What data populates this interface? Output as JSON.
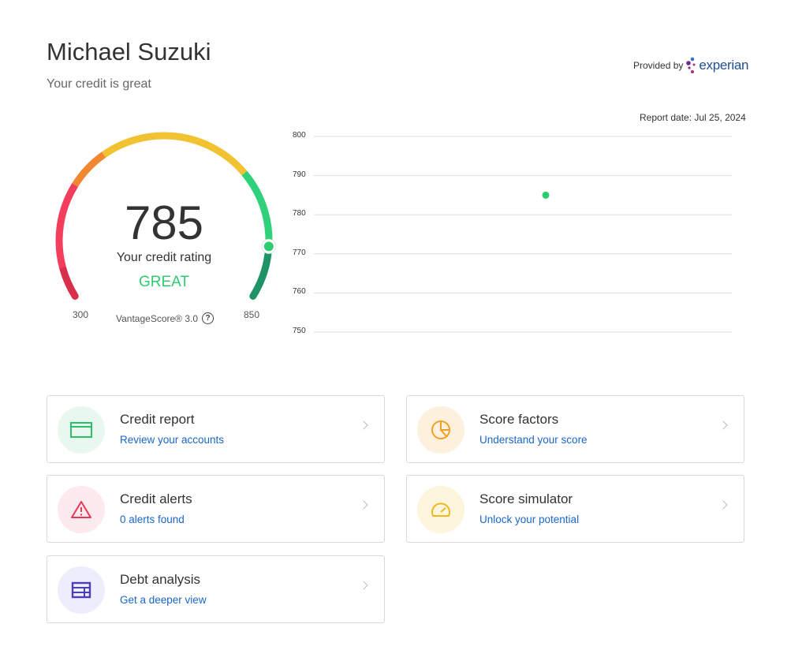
{
  "header": {
    "name": "Michael Suzuki",
    "subtitle": "Your credit is great",
    "provided_by": "Provided by",
    "provider_logo": "experian",
    "report_date": "Report date: Jul 25, 2024"
  },
  "gauge": {
    "score": "785",
    "score_value": 785,
    "min": "300",
    "max": "850",
    "min_value": 300,
    "max_value": 850,
    "rating_label": "Your credit rating",
    "rating": "GREAT",
    "model": "VantageScore® 3.0",
    "help_icon": "question-circle-icon",
    "rating_color": "#2ecc71"
  },
  "chart_data": {
    "type": "scatter",
    "title": "",
    "xlabel": "",
    "ylabel": "",
    "ylim": [
      750,
      800
    ],
    "yticks": [
      "800",
      "790",
      "780",
      "770",
      "760",
      "750"
    ],
    "grid": true,
    "points": [
      {
        "y": 785
      }
    ],
    "color": "#2ecc71"
  },
  "cards": [
    {
      "title": "Credit report",
      "subtitle": "Review your accounts",
      "icon": "credit-card-icon",
      "color": "#2ebd6b",
      "bg": "#e9f8ef"
    },
    {
      "title": "Score factors",
      "subtitle": "Understand your score",
      "icon": "pie-chart-icon",
      "color": "#f0a020",
      "bg": "#fdf1de"
    },
    {
      "title": "Credit alerts",
      "subtitle": "0 alerts found",
      "icon": "warning-icon",
      "color": "#e8385a",
      "bg": "#fdeaee"
    },
    {
      "title": "Score simulator",
      "subtitle": "Unlock your potential",
      "icon": "speedometer-icon",
      "color": "#f0b820",
      "bg": "#fdf5dc"
    },
    {
      "title": "Debt analysis",
      "subtitle": "Get a deeper view",
      "icon": "table-icon",
      "color": "#4b3fb8",
      "bg": "#eeedfb"
    }
  ]
}
